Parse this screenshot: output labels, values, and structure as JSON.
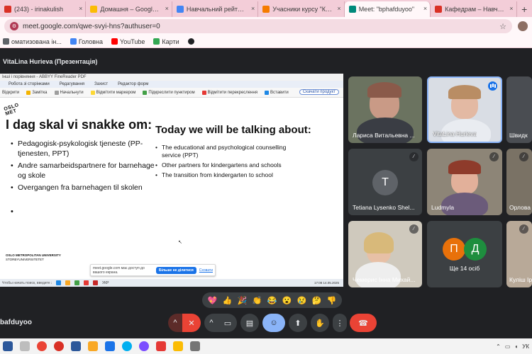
{
  "browser": {
    "tabs": [
      {
        "label": "(243) - irinakulish",
        "color": "#d93025",
        "active": false
      },
      {
        "label": "Домашня – Google Диск",
        "color": "#fbbc04",
        "active": false
      },
      {
        "label": "Навчальний рейтинг Кул",
        "color": "#4285f4",
        "active": false
      },
      {
        "label": "Учасники курсу \"Кафедра",
        "color": "#f57c00",
        "active": false
      },
      {
        "label": "Meet: \"bphafduyoo\"",
        "color": "#00897b",
        "active": true
      },
      {
        "label": "Кафедрам – Навчально-м",
        "color": "#d93025",
        "active": false
      }
    ],
    "new_tab_symbol": "+",
    "close_symbol": "×",
    "url": "meet.google.com/qwe-svyi-hns?authuser=0",
    "bookmarks": [
      {
        "label": "оматизована ін...",
        "color": "#5f6368"
      },
      {
        "label": "Головна",
        "color": "#4285f4"
      },
      {
        "label": "YouTube",
        "color": "#ff0000"
      },
      {
        "label": "Карти",
        "color": "#34a853"
      },
      {
        "label": "",
        "color": "#202124"
      }
    ]
  },
  "meet": {
    "presenter_label": "VitaLina Hurieva (Презентація)",
    "meeting_code": "bafduyoo",
    "slide": {
      "window_title": "Інші і порівняння - ABBYY FineReader PDF",
      "menu": [
        "Робота зі сторінками",
        "Редагування",
        "Захист",
        "Редактор форм"
      ],
      "toolbar": [
        "Відкрити",
        "Замітка",
        "Начальнути",
        "Відмітити маркером",
        "Підкреслити пунктиром",
        "Відмітити перекреслення",
        "Вставити"
      ],
      "save_button": "Скачати продукт",
      "logo": "OSLO MET",
      "heading_left": "I dag skal vi snakke om:",
      "heading_right": "Today we will be talking about:",
      "bullets_left": [
        "Pedagogisk-psykologisk tjeneste (PP-tjenesten, PPT)",
        "Andre samarbeidspartnere for barnehage og skole",
        "Overgangen fra barnehagen til skolen"
      ],
      "empty_bullet": "•",
      "bullets_right": [
        "The educational and psychological counselling service (PPT)",
        "Other partners for kindergartens and schools",
        "The transition from kindergarten to school"
      ],
      "university_line1": "OSLO METROPOLITAN UNIVERSITY",
      "university_line2": "STORBYUNIVERSITETET",
      "share_text": "meet.google.com має доступ до вашого екрана.",
      "share_stop": "Більше не ділитися",
      "share_hide": "Сховати",
      "taskbar_search": "Чтобы начать поиск, введите запит тут",
      "taskbar_clock": "17:08 14.05.2025",
      "taskbar_lang": "УКР"
    },
    "participants": [
      {
        "name": "Лариса Витальевна ...",
        "muted": false
      },
      {
        "name": "VitaLina Hurieva",
        "muted": false,
        "speaking": true
      },
      {
        "name": "Швидк",
        "muted": false
      },
      {
        "name": "Tetiana Lysenko Shel...",
        "muted": true,
        "initial": "T",
        "avatar_color": "#5f6368"
      },
      {
        "name": "Ludmyla",
        "muted": true
      },
      {
        "name": "Орлова",
        "muted": false
      },
      {
        "name": "Чемерис Інна Михай...",
        "muted": true
      },
      {
        "name": "Ще 14 осіб",
        "avatars": [
          {
            "letter": "П",
            "color": "#e8710a"
          },
          {
            "letter": "Д",
            "color": "#1e8e3e"
          }
        ]
      },
      {
        "name": "Куліш Ір",
        "muted": false
      }
    ],
    "reactions": [
      "💖",
      "👍",
      "🎉",
      "👏",
      "😂",
      "😮",
      "😢",
      "🤔",
      "👎"
    ],
    "controls": {
      "more_symbol": "^",
      "mic_symbol": "✕",
      "camera_symbol": "▭",
      "captions_symbol": "▤",
      "emoji_symbol": "☺",
      "present_symbol": "⬆",
      "hand_symbol": "✋",
      "more_options_symbol": "⋮",
      "end_call_symbol": "☎"
    }
  },
  "windows_taskbar": {
    "lang": "УК",
    "icons": [
      "#2b579a",
      "#1e88e5",
      "#ea4335",
      "#d93025",
      "#2b579a",
      "#f9a825",
      "#1a73e8",
      "#00aff0",
      "#7c4dff",
      "#e53935",
      "#fbbc04",
      "#757575"
    ]
  }
}
